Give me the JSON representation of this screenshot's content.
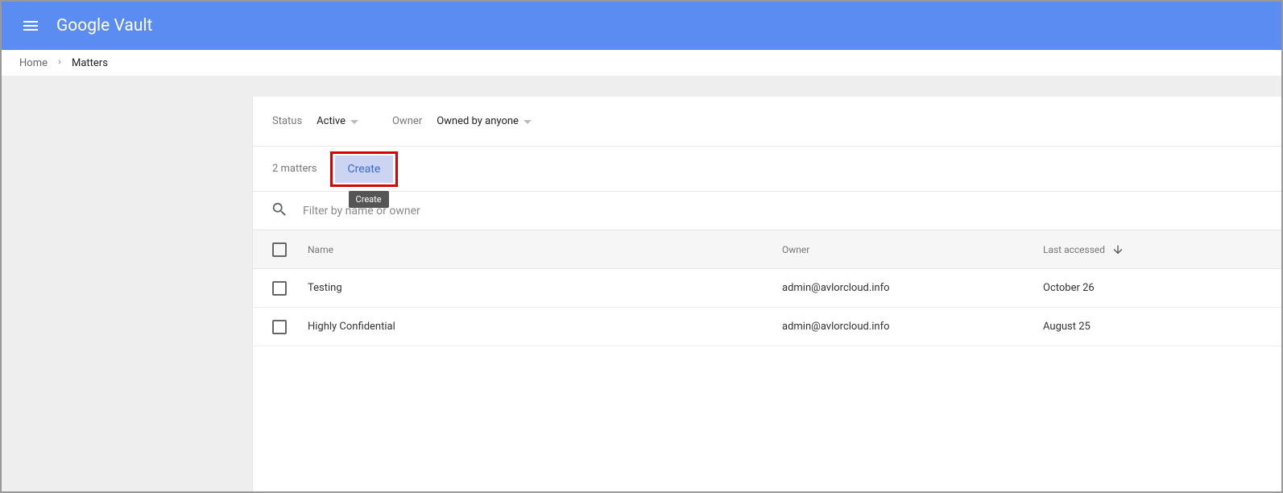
{
  "header": {
    "title": "Google Vault"
  },
  "breadcrumb": {
    "home": "Home",
    "current": "Matters"
  },
  "filters": {
    "status_label": "Status",
    "status_value": "Active",
    "owner_label": "Owner",
    "owner_value": "Owned by anyone"
  },
  "toolbar": {
    "count": "2 matters",
    "create_label": "Create",
    "tooltip": "Create"
  },
  "search": {
    "placeholder": "Filter by name or owner"
  },
  "table": {
    "headers": {
      "name": "Name",
      "owner": "Owner",
      "last": "Last accessed"
    },
    "rows": [
      {
        "name": "Testing",
        "owner": "admin@avlorcloud.info",
        "last": "October 26"
      },
      {
        "name": "Highly Confidential",
        "owner": "admin@avlorcloud.info",
        "last": "August 25"
      }
    ]
  }
}
